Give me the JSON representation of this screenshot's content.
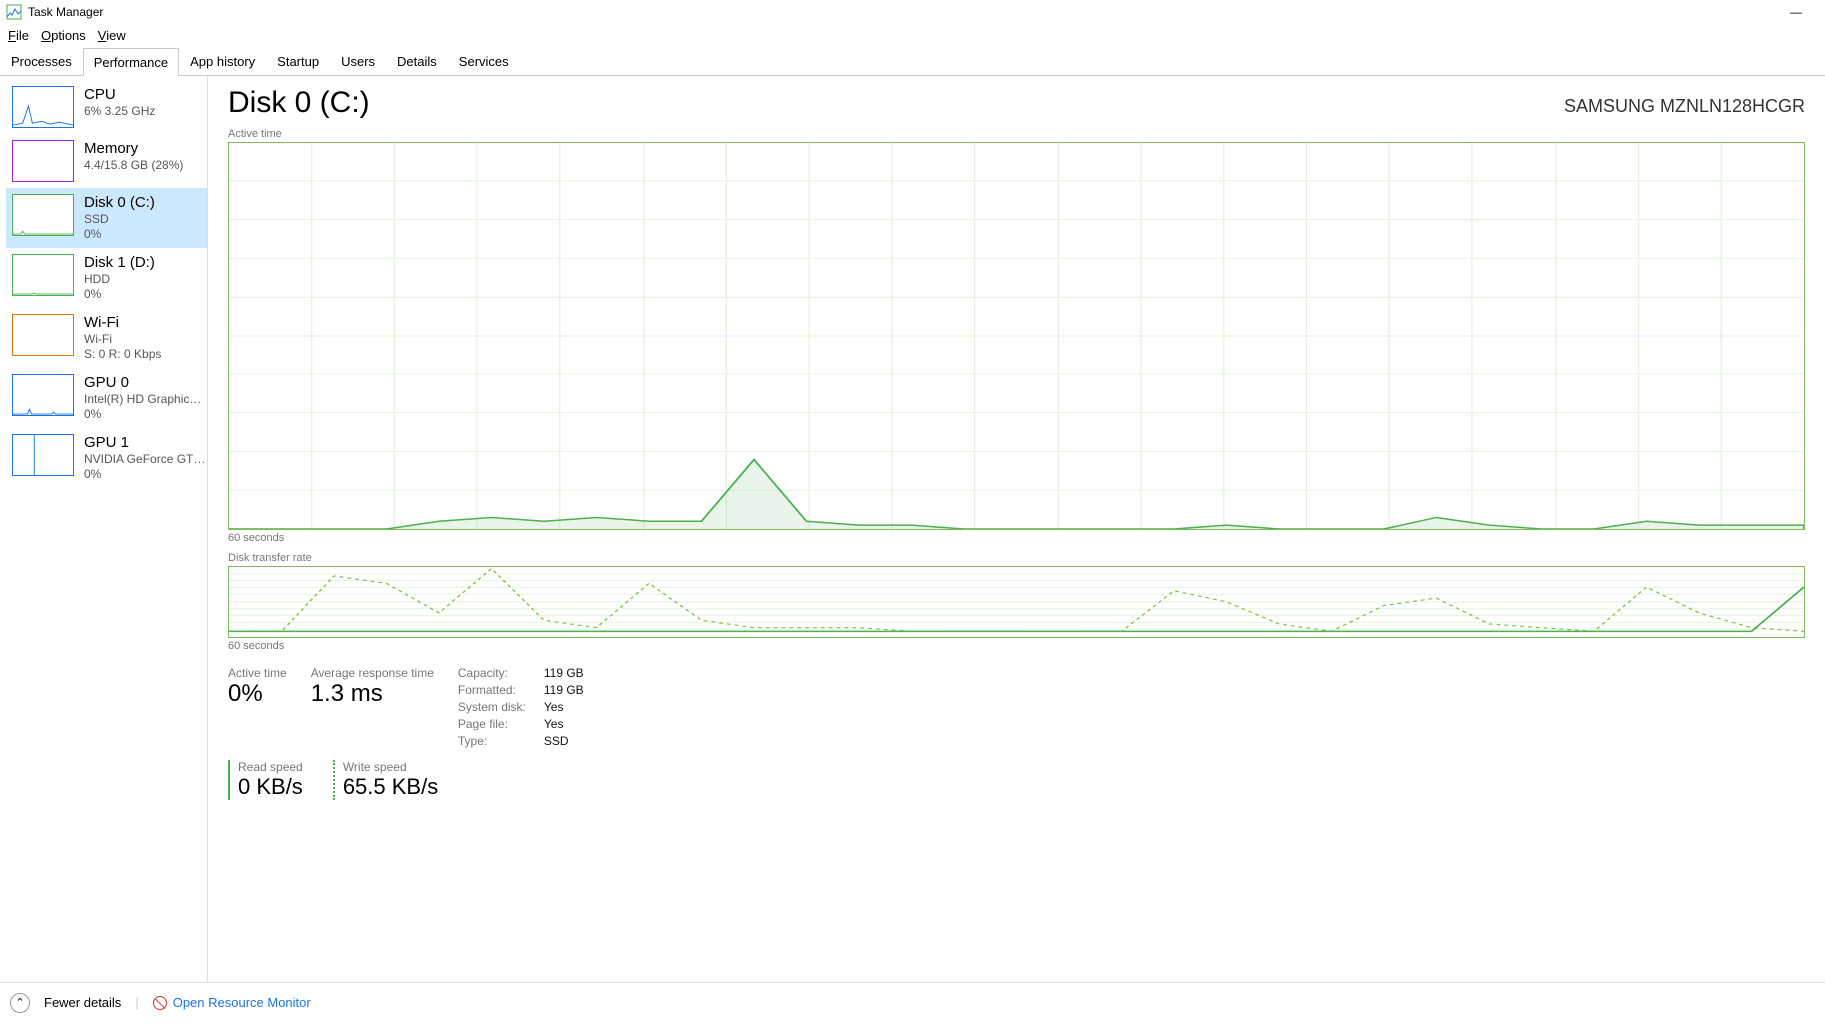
{
  "window": {
    "title": "Task Manager",
    "menu": {
      "file": "File",
      "options": "Options",
      "view": "View"
    },
    "controls": {
      "minimize": "—"
    }
  },
  "tabs": [
    "Processes",
    "Performance",
    "App history",
    "Startup",
    "Users",
    "Details",
    "Services"
  ],
  "active_tab": "Performance",
  "sidebar": [
    {
      "key": "cpu",
      "title": "CPU",
      "line1": "6% 3.25 GHz",
      "line2": "",
      "color": "#1a73e8"
    },
    {
      "key": "memory",
      "title": "Memory",
      "line1": "4.4/15.8 GB (28%)",
      "line2": "",
      "color": "#a020f0"
    },
    {
      "key": "disk0",
      "title": "Disk 0 (C:)",
      "line1": "SSD",
      "line2": "0%",
      "color": "#4caf50",
      "selected": true
    },
    {
      "key": "disk1",
      "title": "Disk 1 (D:)",
      "line1": "HDD",
      "line2": "0%",
      "color": "#4caf50"
    },
    {
      "key": "wifi",
      "title": "Wi-Fi",
      "line1": "Wi-Fi",
      "line2": "S: 0 R: 0 Kbps",
      "color": "#d97706"
    },
    {
      "key": "gpu0",
      "title": "GPU 0",
      "line1": "Intel(R) HD Graphics ...",
      "line2": "0%",
      "color": "#1a73e8"
    },
    {
      "key": "gpu1",
      "title": "GPU 1",
      "line1": "NVIDIA GeForce GTX...",
      "line2": "0%",
      "color": "#1a73e8"
    }
  ],
  "main": {
    "heading": "Disk 0 (C:)",
    "model": "SAMSUNG MZNLN128HCGR",
    "chart1_label": "Active time",
    "chart1_xaxis": "60 seconds",
    "chart2_label": "Disk transfer rate",
    "chart2_xaxis": "60 seconds",
    "stats": {
      "active_time_label": "Active time",
      "active_time_value": "0%",
      "avg_resp_label": "Average response time",
      "avg_resp_value": "1.3 ms",
      "read_label": "Read speed",
      "read_value": "0 KB/s",
      "write_label": "Write speed",
      "write_value": "65.5 KB/s"
    },
    "kv": {
      "capacity_k": "Capacity:",
      "capacity_v": "119 GB",
      "formatted_k": "Formatted:",
      "formatted_v": "119 GB",
      "sysdisk_k": "System disk:",
      "sysdisk_v": "Yes",
      "pagefile_k": "Page file:",
      "pagefile_v": "Yes",
      "type_k": "Type:",
      "type_v": "SSD"
    }
  },
  "footer": {
    "fewer": "Fewer details",
    "open_rm": "Open Resource Monitor"
  },
  "chart_data": [
    {
      "type": "line",
      "title": "Active time",
      "xlabel": "60 seconds",
      "ylabel": "%",
      "ylim": [
        0,
        100
      ],
      "x_seconds_ago": [
        60,
        58,
        56,
        54,
        52,
        50,
        48,
        46,
        44,
        42,
        40,
        38,
        36,
        34,
        32,
        30,
        28,
        26,
        24,
        22,
        20,
        18,
        16,
        14,
        12,
        10,
        8,
        6,
        4,
        2,
        0
      ],
      "series": [
        {
          "name": "Active time %",
          "values": [
            0,
            0,
            0,
            0,
            2,
            3,
            2,
            3,
            2,
            2,
            18,
            2,
            1,
            1,
            0,
            0,
            0,
            0,
            0,
            1,
            0,
            0,
            0,
            3,
            1,
            0,
            0,
            2,
            1,
            1,
            1
          ]
        }
      ]
    },
    {
      "type": "line",
      "title": "Disk transfer rate",
      "xlabel": "60 seconds",
      "ylabel": "KB/s",
      "x_seconds_ago": [
        60,
        58,
        56,
        54,
        52,
        50,
        48,
        46,
        44,
        42,
        40,
        38,
        36,
        34,
        32,
        30,
        28,
        26,
        24,
        22,
        20,
        18,
        16,
        14,
        12,
        10,
        8,
        6,
        4,
        2,
        0
      ],
      "series": [
        {
          "name": "Read",
          "style": "dotted",
          "values": [
            5,
            5,
            80,
            70,
            30,
            90,
            20,
            10,
            70,
            20,
            10,
            10,
            10,
            5,
            5,
            5,
            5,
            5,
            60,
            45,
            15,
            5,
            40,
            50,
            15,
            10,
            5,
            65,
            30,
            10,
            5
          ]
        },
        {
          "name": "Write",
          "style": "solid",
          "values": [
            5,
            5,
            5,
            5,
            5,
            5,
            5,
            5,
            5,
            5,
            5,
            5,
            5,
            5,
            5,
            5,
            5,
            5,
            5,
            5,
            5,
            5,
            5,
            5,
            5,
            5,
            5,
            5,
            5,
            5,
            65
          ]
        }
      ]
    }
  ]
}
